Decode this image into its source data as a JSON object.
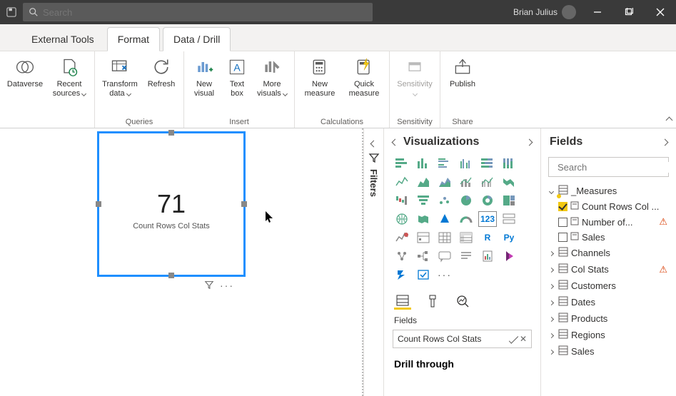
{
  "titlebar": {
    "search_placeholder": "Search",
    "username": "Brian Julius"
  },
  "tabs": {
    "external_tools": "External Tools",
    "format": "Format",
    "data_drill": "Data / Drill"
  },
  "ribbon": {
    "dataverse": "Dataverse",
    "recent_sources": "Recent sources",
    "transform_data": "Transform data",
    "refresh": "Refresh",
    "new_visual": "New visual",
    "text_box": "Text box",
    "more_visuals": "More visuals",
    "new_measure": "New measure",
    "quick_measure": "Quick measure",
    "sensitivity": "Sensitivity",
    "publish": "Publish",
    "group_queries": "Queries",
    "group_insert": "Insert",
    "group_calculations": "Calculations",
    "group_sensitivity": "Sensitivity",
    "group_share": "Share"
  },
  "card": {
    "value": "71",
    "label": "Count Rows Col Stats"
  },
  "filters_label": "Filters",
  "viz": {
    "title": "Visualizations",
    "fields_label": "Fields",
    "well_value": "Count Rows Col Stats",
    "drill_title": "Drill through"
  },
  "fields": {
    "title": "Fields",
    "search_placeholder": "Search",
    "measures_table": "_Measures",
    "measure_count": "Count Rows Col ...",
    "measure_number_of": "Number of...",
    "measure_sales": "Sales",
    "tables": [
      "Channels",
      "Col Stats",
      "Customers",
      "Dates",
      "Products",
      "Regions",
      "Sales"
    ]
  }
}
